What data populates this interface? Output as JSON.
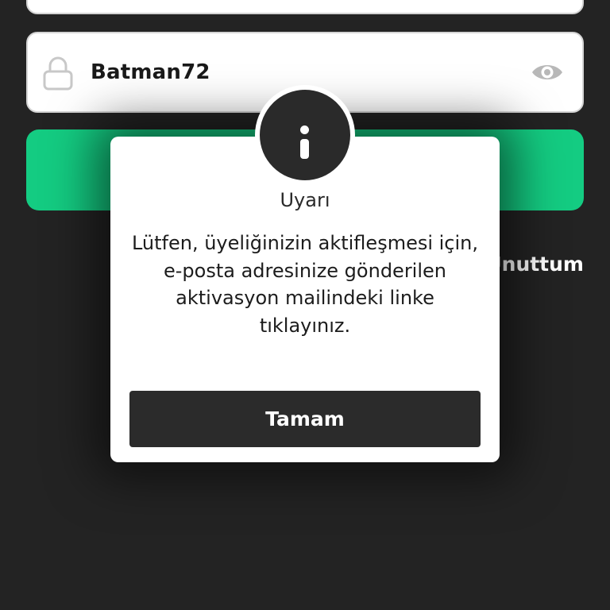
{
  "form": {
    "password_value": "Batman72",
    "forgot_link": "Şifremi Unuttum",
    "login_button_color": "#14cc82"
  },
  "icons": {
    "field_left": "lock-icon",
    "field_right": "eye-icon",
    "dialog_badge": "info-icon"
  },
  "dialog": {
    "title": "Uyarı",
    "message": "Lütfen, üyeliğinizin aktifleşmesi için, e-posta adresinize gönderilen aktivasyon mailindeki linke tıklayınız.",
    "button_label": "Tamam"
  },
  "colors": {
    "background": "#232323",
    "accent": "#14cc82",
    "dialog_button": "#2b2b2b"
  }
}
